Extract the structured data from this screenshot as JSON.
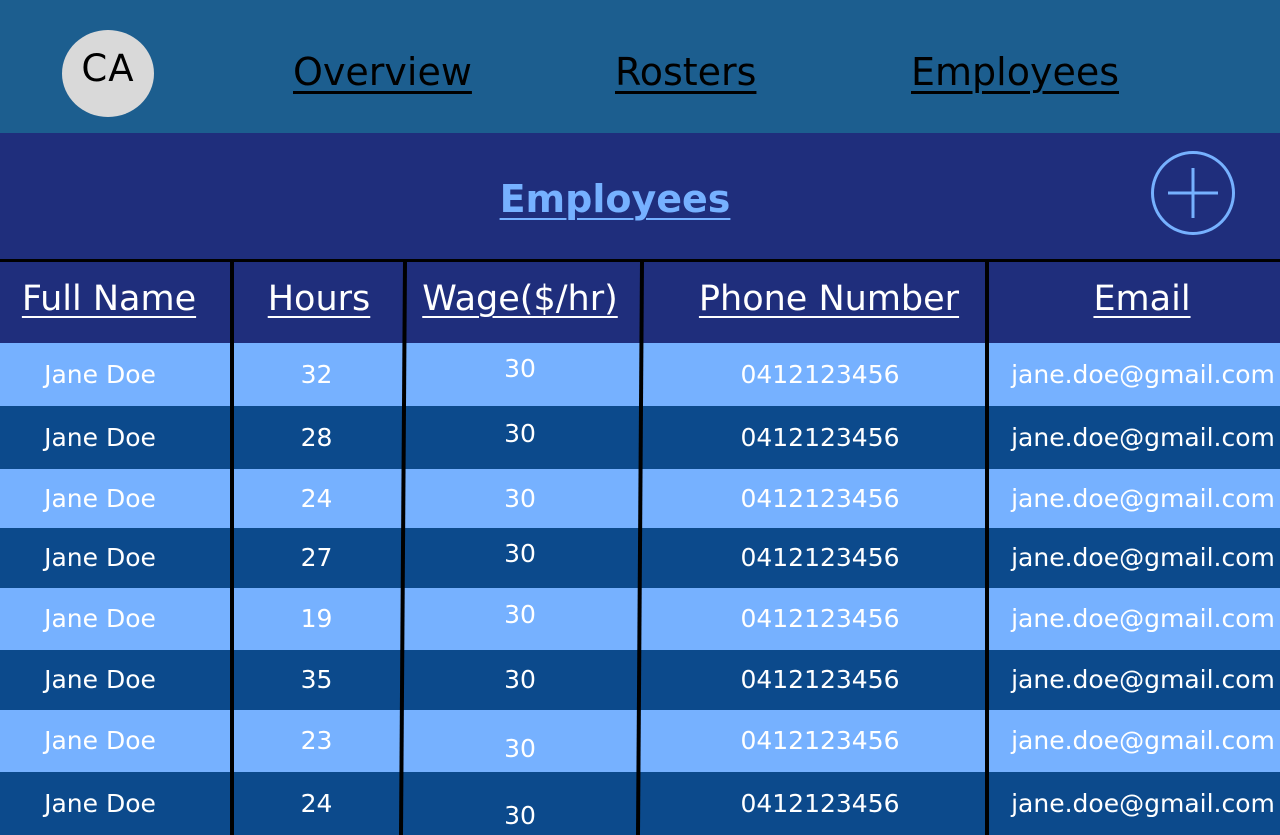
{
  "nav": {
    "avatar_initials": "CA",
    "links": [
      "Overview",
      "Rosters",
      "Employees"
    ]
  },
  "page": {
    "title": "Employees",
    "add_icon": "plus-circle-icon"
  },
  "table": {
    "columns": [
      "Full Name",
      "Hours",
      "Wage($/hr)",
      "Phone Number",
      "Email"
    ],
    "rows": [
      {
        "name": "Jane Doe",
        "hours": "32",
        "wage": "30",
        "phone": "0412123456",
        "email": "jane.doe@gmail.com"
      },
      {
        "name": "Jane Doe",
        "hours": "28",
        "wage": "30",
        "phone": "0412123456",
        "email": "jane.doe@gmail.com"
      },
      {
        "name": "Jane Doe",
        "hours": "24",
        "wage": "30",
        "phone": "0412123456",
        "email": "jane.doe@gmail.com"
      },
      {
        "name": "Jane Doe",
        "hours": "27",
        "wage": "30",
        "phone": "0412123456",
        "email": "jane.doe@gmail.com"
      },
      {
        "name": "Jane Doe",
        "hours": "19",
        "wage": "30",
        "phone": "0412123456",
        "email": "jane.doe@gmail.com"
      },
      {
        "name": "Jane Doe",
        "hours": "35",
        "wage": "30",
        "phone": "0412123456",
        "email": "jane.doe@gmail.com"
      },
      {
        "name": "Jane Doe",
        "hours": "23",
        "wage": "30",
        "phone": "0412123456",
        "email": "jane.doe@gmail.com"
      },
      {
        "name": "Jane Doe",
        "hours": "24",
        "wage": "30",
        "phone": "0412123456",
        "email": "jane.doe@gmail.com"
      }
    ]
  },
  "colors": {
    "topbar": "#1c5e8f",
    "header_band": "#1f2e7c",
    "accent": "#76b1ff",
    "row_light": "#76b1ff",
    "row_dark": "#0c4a8c"
  }
}
